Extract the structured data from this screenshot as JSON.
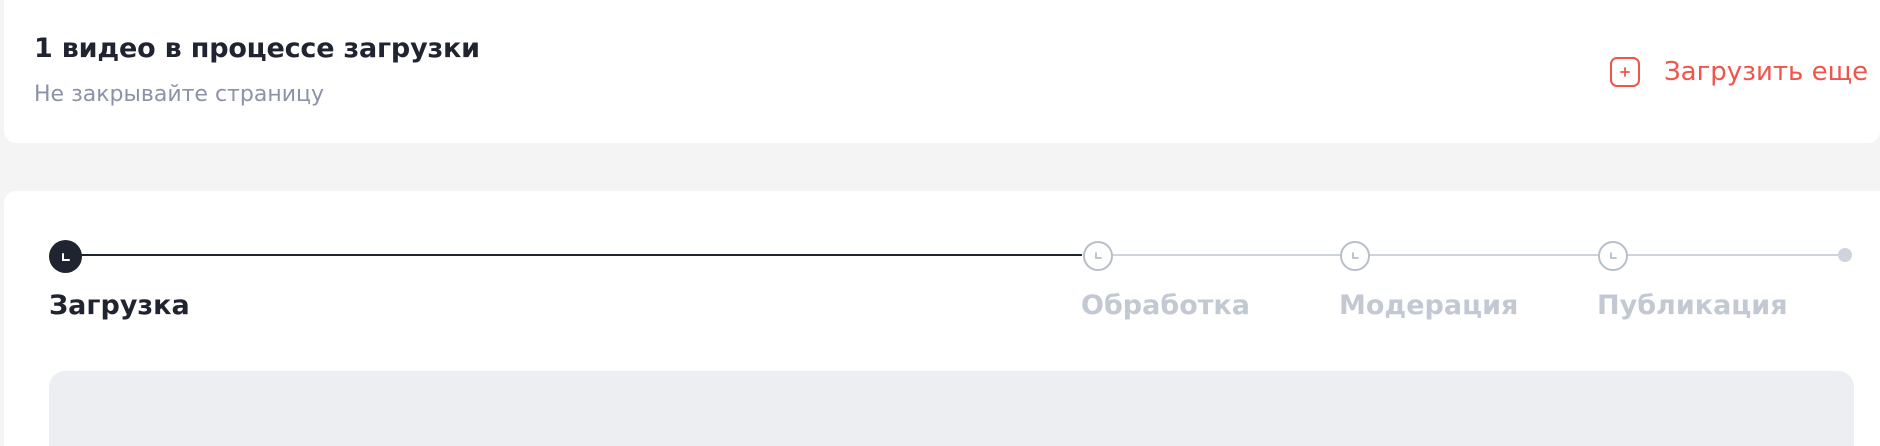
{
  "upload_status": {
    "title": "1 видео в процессе загрузки",
    "subtitle": "Не закрывайте страницу",
    "upload_more_label": "Загрузить еще",
    "upload_more_icon": "plus-square-icon",
    "accent_color": "#f0554c"
  },
  "progress": {
    "steps": [
      {
        "label": "Загрузка",
        "state": "active",
        "icon": "clock-icon"
      },
      {
        "label": "Обработка",
        "state": "pending",
        "icon": "clock-icon"
      },
      {
        "label": "Модерация",
        "state": "pending",
        "icon": "clock-icon"
      },
      {
        "label": "Публикация",
        "state": "pending",
        "icon": "clock-icon"
      }
    ],
    "active_color": "#1f2430",
    "pending_color": "#c3c9d3"
  }
}
